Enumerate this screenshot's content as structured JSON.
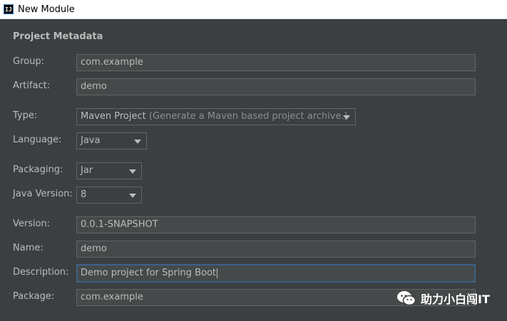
{
  "window": {
    "title": "New Module",
    "app_icon": "IJ"
  },
  "section_title": "Project Metadata",
  "fields": {
    "group": {
      "label": "Group:",
      "value": "com.example"
    },
    "artifact": {
      "label": "Artifact:",
      "value": "demo"
    },
    "type": {
      "label": "Type:",
      "value": "Maven Project",
      "hint": "(Generate a Maven based project archive.)"
    },
    "language": {
      "label": "Language:",
      "value": "Java"
    },
    "packaging": {
      "label": "Packaging:",
      "value": "Jar"
    },
    "java_version": {
      "label": "Java Version:",
      "value": "8"
    },
    "version": {
      "label": "Version:",
      "value": "0.0.1-SNAPSHOT"
    },
    "name": {
      "label": "Name:",
      "value": "demo"
    },
    "description": {
      "label": "Description:",
      "value": "Demo project for Spring Boot"
    },
    "package": {
      "label": "Package:",
      "value": "com.example"
    }
  },
  "watermark": {
    "text": "助力小白闯IT",
    "icon": "wechat-icon"
  },
  "colors": {
    "background": "#3c3f41",
    "field_bg": "#45494a",
    "focus_border": "#3d6185",
    "text": "#bbbbbb"
  }
}
